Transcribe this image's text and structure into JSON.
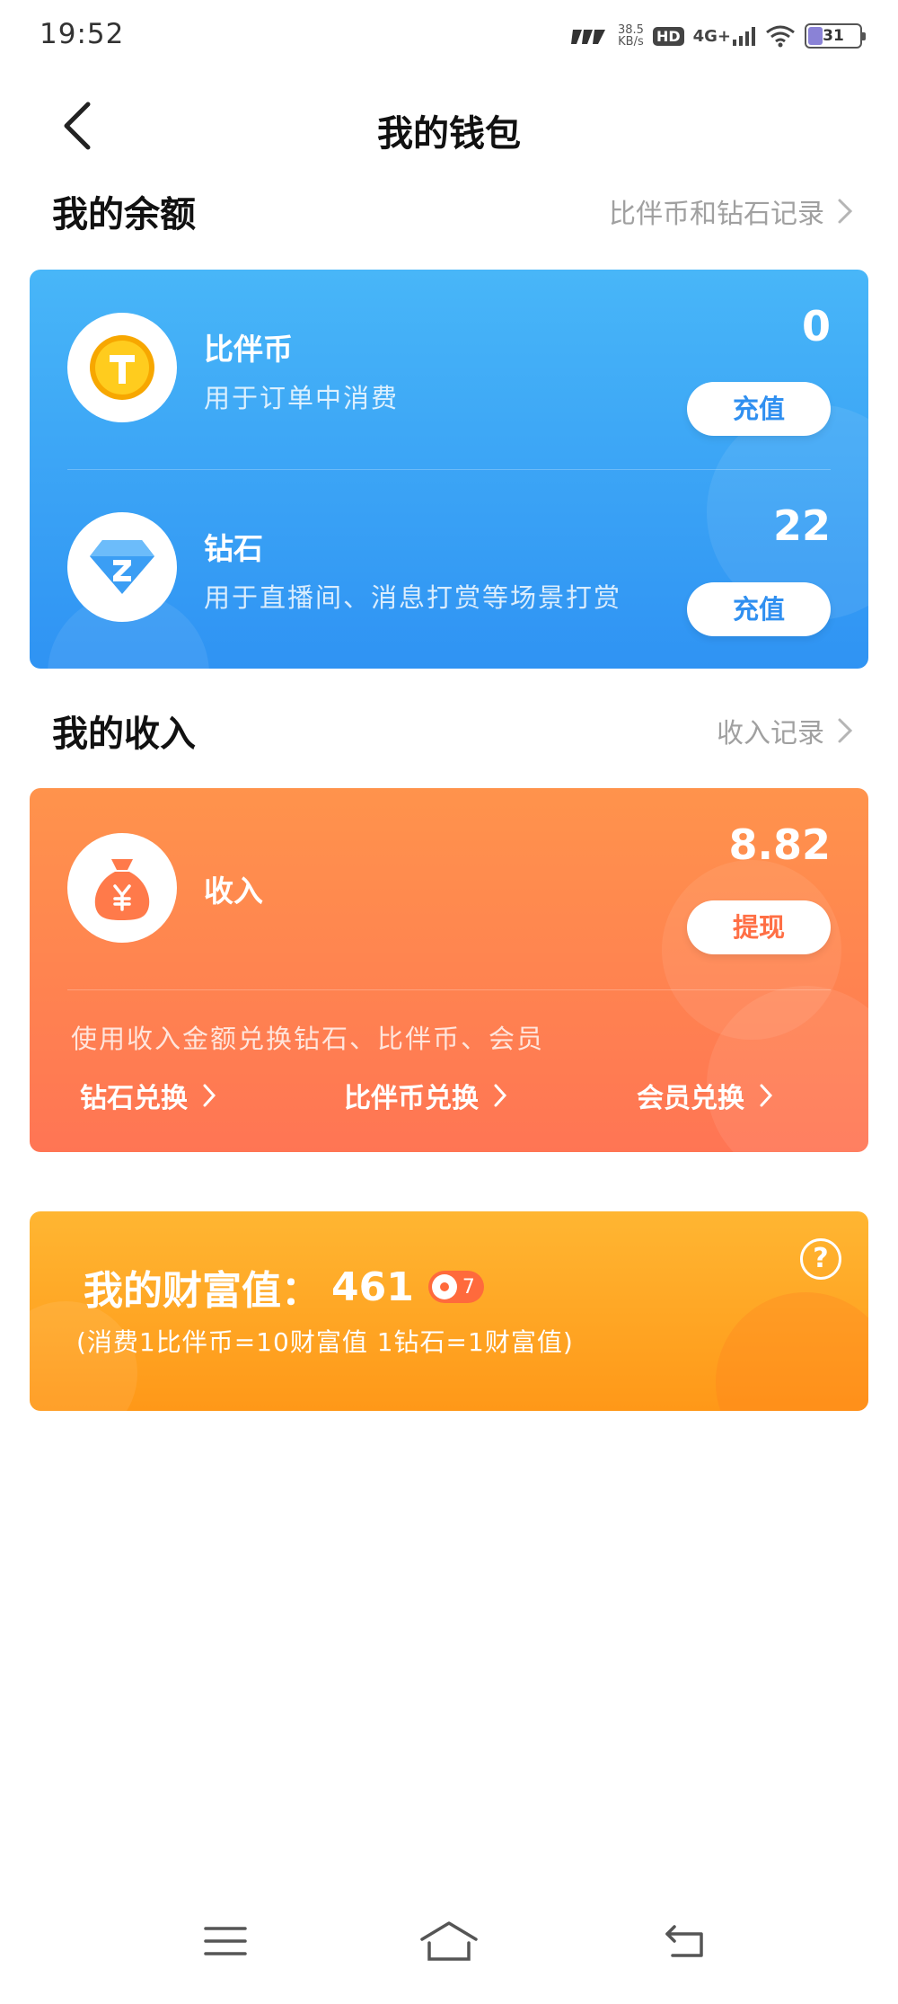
{
  "status_bar": {
    "time": "19:52",
    "speed_value": "38.5",
    "speed_unit": "KB/s",
    "hd": "HD",
    "network": "4G+",
    "battery": "31"
  },
  "header": {
    "title": "我的钱包",
    "back_icon": "chevron-left-icon"
  },
  "balance_section": {
    "title": "我的余额",
    "link": "比伴币和钻石记录",
    "items": [
      {
        "name": "比伴币",
        "desc": "用于订单中消费",
        "amount": "0",
        "button": "充值",
        "icon": "coin-icon"
      },
      {
        "name": "钻石",
        "desc": "用于直播间、消息打赏等场景打赏",
        "amount": "22",
        "button": "充值",
        "icon": "diamond-icon"
      }
    ]
  },
  "income_section": {
    "title": "我的收入",
    "link": "收入记录",
    "name": "收入",
    "amount": "8.82",
    "button": "提现",
    "icon": "money-bag-icon",
    "note": "使用收入金额兑换钻石、比伴币、会员",
    "exchanges": [
      "钻石兑换",
      "比伴币兑换",
      "会员兑换"
    ]
  },
  "wealth": {
    "label": "我的财富值：",
    "value": "461",
    "level": "7",
    "note": "(消费1比伴币=10财富值 1钻石=1财富值)",
    "help": "?"
  },
  "colors": {
    "blue_card": "#3aa4f6",
    "orange_card": "#ff8450",
    "gold_card": "#ffa625"
  },
  "navbar": {
    "icons": [
      "menu-icon",
      "home-icon",
      "back-icon"
    ]
  }
}
